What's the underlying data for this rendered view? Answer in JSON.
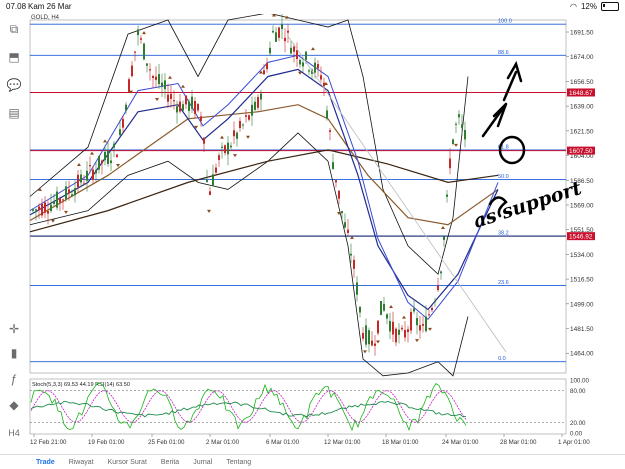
{
  "status": {
    "time": "07.08",
    "date": "Kam 26 Mar",
    "battery": "12%"
  },
  "chart": {
    "symbol": "GOLD, H4",
    "price_axis": [
      "1691.50",
      "1674.00",
      "1656.50",
      "1639.00",
      "1621.50",
      "1604.00",
      "1586.50",
      "1569.00",
      "1551.50",
      "1534.00",
      "1516.50",
      "1499.00",
      "1481.50",
      "1464.00"
    ],
    "time_axis": [
      "12 Feb 21:00",
      "19 Feb 01:00",
      "25 Feb 01:00",
      "2 Mar 01:00",
      "6 Mar 01:00",
      "12 Mar 01:00",
      "18 Mar 01:00",
      "24 Mar 01:00",
      "28 Mar 01:00",
      "1 Apr 01:00"
    ],
    "fib_levels": [
      {
        "label": "100.0"
      },
      {
        "label": "88.6"
      },
      {
        "label": "61.8"
      },
      {
        "label": "50.0"
      },
      {
        "label": "38.2"
      },
      {
        "label": "23.6"
      },
      {
        "label": "0.0"
      }
    ],
    "price_tags": [
      {
        "text": "1648.67",
        "color": "#c8102e"
      },
      {
        "text": "1607.50",
        "color": "#c8102e"
      },
      {
        "text": "1546.92",
        "color": "#c8102e"
      }
    ],
    "stoch_label": "Stoch(5,3,3) 69.53 44.19 RSI(14) 63.50",
    "stoch_axis": [
      "100.00",
      "80.00",
      "20.00",
      "0.00"
    ],
    "annotation": "as support"
  },
  "bottom_tabs": [
    {
      "label": "Trade",
      "active": true
    },
    {
      "label": "Riwayat",
      "active": false
    },
    {
      "label": "Kursor Surat",
      "active": false
    },
    {
      "label": "Berita",
      "active": false
    },
    {
      "label": "Jurnal",
      "active": false
    },
    {
      "label": "Tentang",
      "active": false
    }
  ],
  "toolbar": {
    "icons": [
      "pages-icon",
      "profile-icon",
      "chat-icon",
      "add-doc-icon",
      "crosshair-icon",
      "candles-icon",
      "function-icon",
      "objects-icon",
      "timeframe-label"
    ],
    "timeframe_label": "H4"
  },
  "colors": {
    "candle_up": "#2e7d32",
    "candle_down": "#c62828",
    "ma_brown": "#8b5a2b",
    "ma_blue": "#1f2c8f",
    "bb": "#111111",
    "fib_blue": "#1e5bd8",
    "red_line": "#c8102e"
  }
}
